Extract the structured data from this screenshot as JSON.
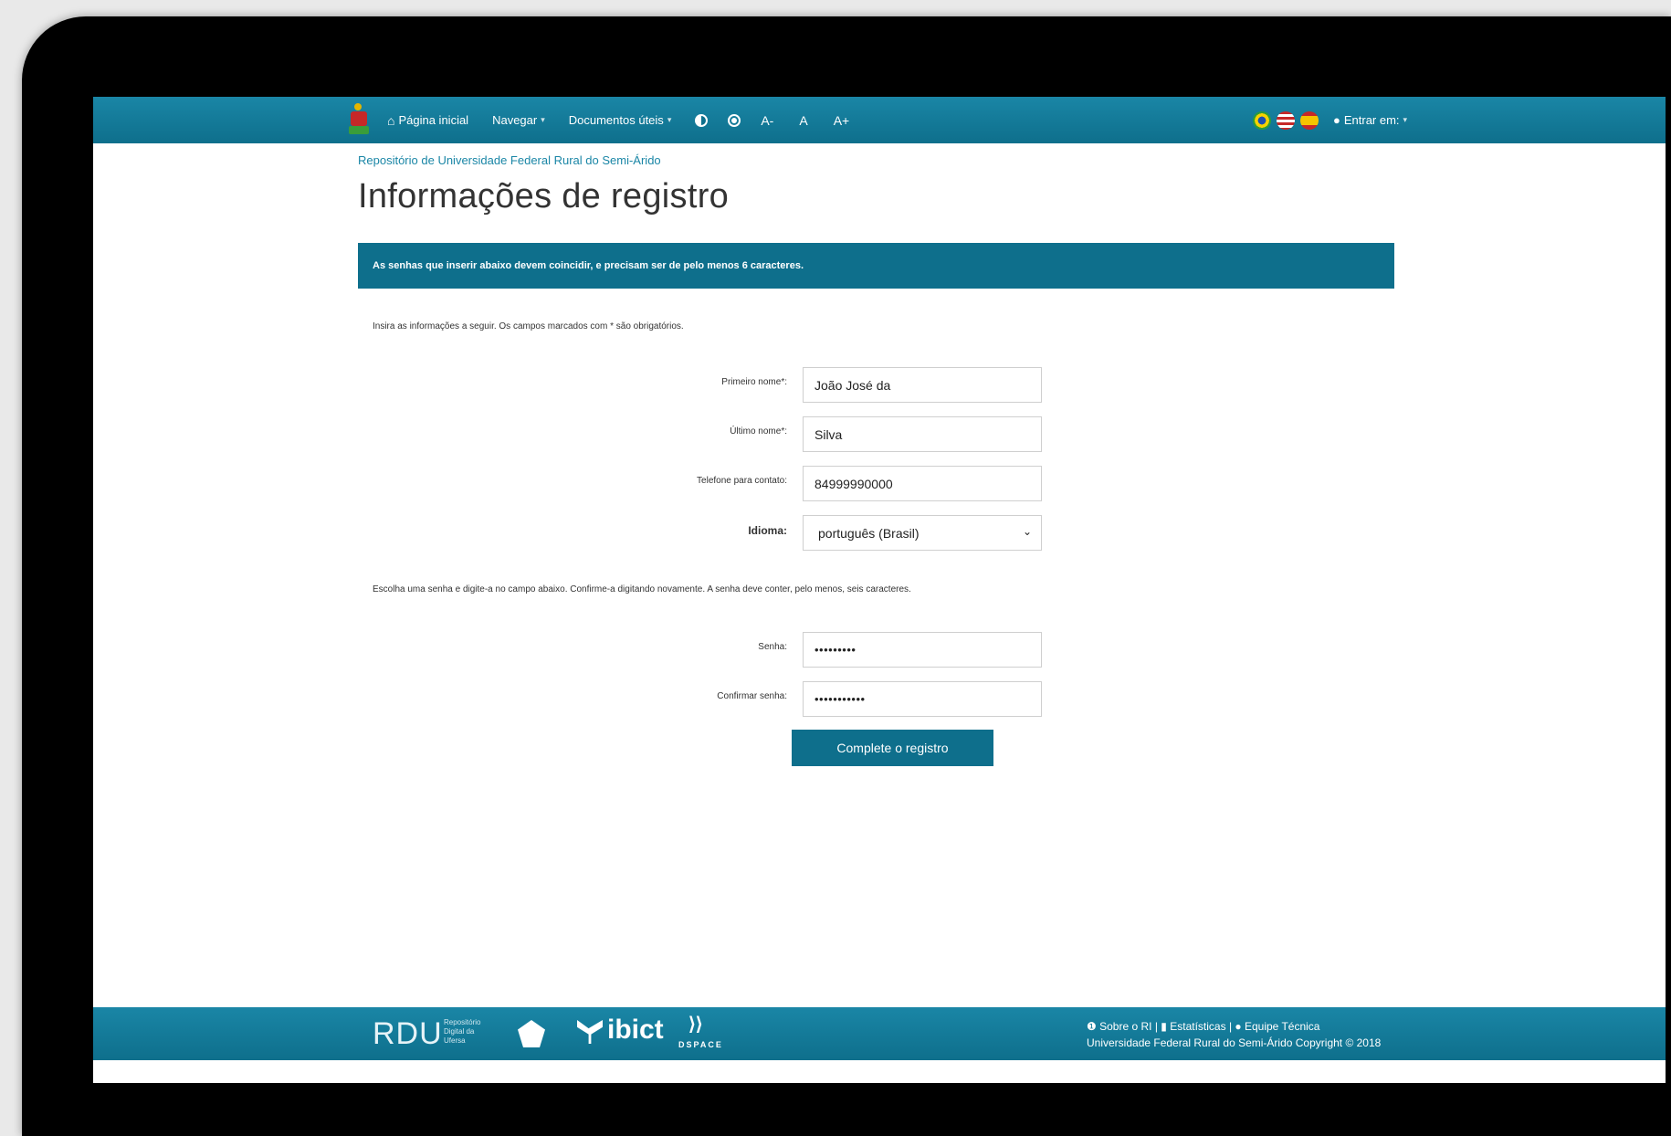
{
  "navbar": {
    "home_label": "Página inicial",
    "browse_label": "Navegar",
    "docs_label": "Documentos úteis",
    "font_decrease": "A-",
    "font_normal": "A",
    "font_increase": "A+",
    "login_label": "Entrar em:",
    "icons": [
      "home-icon",
      "contrast-icon",
      "reset-icon",
      "flag-brazil-icon",
      "flag-usa-icon",
      "flag-spain-icon",
      "user-icon"
    ]
  },
  "breadcrumb": "Repositório de Universidade Federal Rural do Semi-Árido",
  "page_title": "Informações de registro",
  "alert": "As senhas que inserir abaixo devem coincidir, e precisam ser de pelo menos 6 caracteres.",
  "instructions": "Insira as informações a seguir. Os campos marcados com * são obrigatórios.",
  "fields": {
    "first_name_label": "Primeiro nome*:",
    "first_name_value": "João José da",
    "last_name_label": "Último nome*:",
    "last_name_value": "Silva",
    "phone_label": "Telefone para contato:",
    "phone_value": "84999990000",
    "language_label": "Idioma:",
    "language_value": "português (Brasil)"
  },
  "password_instructions": "Escolha uma senha e digite-a no campo abaixo. Confirme-a digitando novamente. A senha deve conter, pelo menos, seis caracteres.",
  "password": {
    "password_label": "Senha:",
    "password_value": "•••••••••",
    "confirm_label": "Confirmar senha:",
    "confirm_value": "•••••••••••"
  },
  "submit_label": "Complete o registro",
  "footer": {
    "rdu_label": "RDU",
    "rdu_sub": "Repositório Digital da Ufersa",
    "ibict_label": "ibict",
    "dspace_label": "DSPACE",
    "about_label": "Sobre o RI",
    "stats_label": "Estatísticas",
    "team_label": "Equipe Técnica",
    "copyright": "Universidade Federal Rural do Semi-Árido Copyright © 2018",
    "colors": {
      "primary": "#0e6f8c",
      "accent": "#1a86a6"
    }
  }
}
